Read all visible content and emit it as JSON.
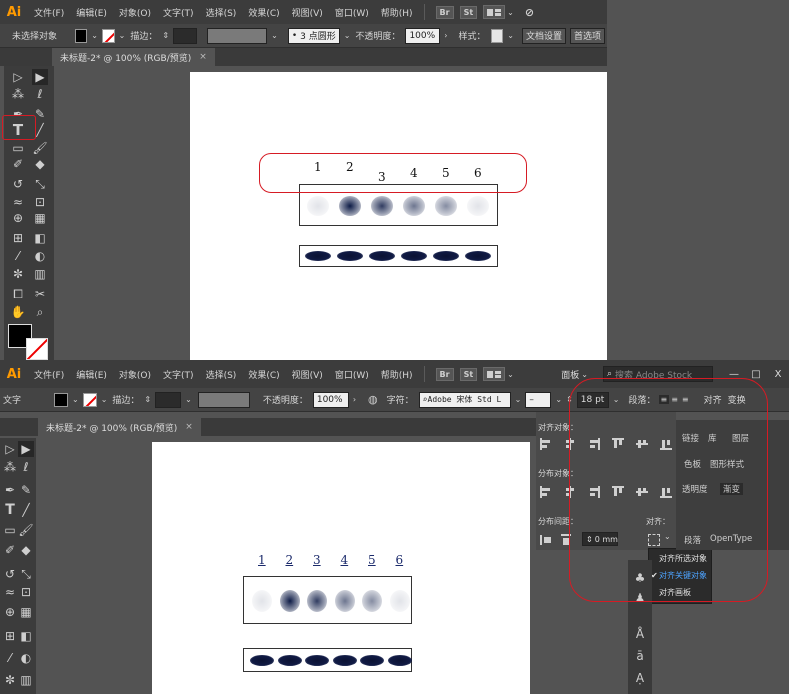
{
  "app_name": "Ai",
  "menus_top": [
    "文件(F)",
    "编辑(E)",
    "对象(O)",
    "文字(T)",
    "选择(S)",
    "效果(C)",
    "视图(V)",
    "窗口(W)",
    "帮助(H)"
  ],
  "menus_bottom": [
    "文件(F)",
    "编辑(E)",
    "对象(O)",
    "文字(T)",
    "选择(S)",
    "效果(C)",
    "视图(V)",
    "窗口(W)",
    "帮助(H)"
  ],
  "bridge_label": "Br",
  "stock_label": "St",
  "workspace_label": "面板",
  "search_placeholder": "搜索 Adobe Stock",
  "window_controls": [
    "—",
    "□",
    "X"
  ],
  "top_control": {
    "selection_status": "未选择对象",
    "stroke_label": "描边：",
    "brush_value": "3 点圆形",
    "opacity_label": "不透明度：",
    "opacity_value": "100%",
    "style_label": "样式：",
    "doc_setup_label": "文档设置",
    "prefs_label": "首选项"
  },
  "bottom_control": {
    "mode_label": "文字",
    "stroke_label": "描边：",
    "opacity_label": "不透明度：",
    "opacity_value": "100%",
    "char_label": "字符：",
    "font_value": "Adobe 宋体 Std L",
    "size_value": "18 pt",
    "para_label": "段落：",
    "align_label": "对齐",
    "transform_label": "变换"
  },
  "doc_tab_title": "未标题-2* @ 100% (RGB/预览)",
  "doc_tab_close": "×",
  "lane_numbers": [
    "1",
    "2",
    "3",
    "4",
    "5",
    "6"
  ],
  "align_panel": {
    "align_objects_title": "对齐对象：",
    "distribute_objects_title": "分布对象：",
    "distribute_spacing_title": "分布间距：",
    "align_to_title": "对齐：",
    "spacing_value": "0 mm",
    "menu_items": [
      "对齐所选对象",
      "对齐关键对象",
      "对齐画板"
    ],
    "checked_index": 1,
    "highlight_color": "#4da3ff"
  },
  "side_tabs": [
    "链接",
    "库",
    "图层",
    "色板",
    "图形样式",
    "透明度",
    "渐变",
    "段落",
    "OpenType"
  ],
  "colors": {
    "ui_bg": "#535353",
    "menu_bg": "#3c3c3c",
    "highlight_red": "#d61b24",
    "ai_orange": "#ff9a00",
    "band_color": "#0c1a45"
  }
}
